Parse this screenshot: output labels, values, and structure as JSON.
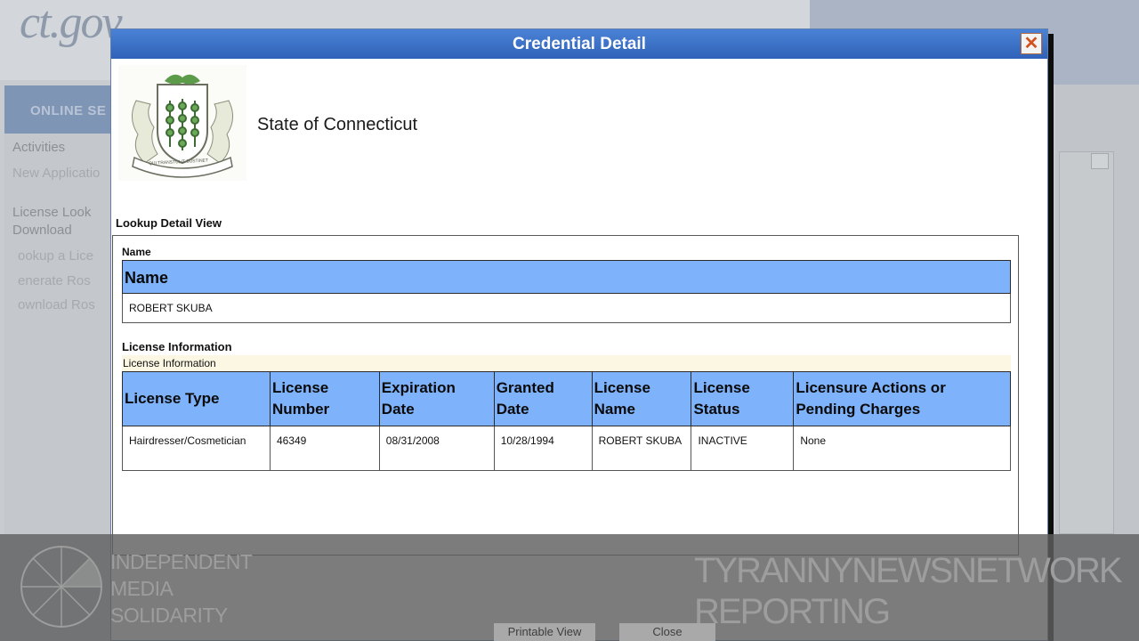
{
  "background": {
    "logo_text": "ct.gov",
    "nav_text": "ONLINE SE",
    "sidebar": {
      "activities": "Activities",
      "new_application": "New Applicatio",
      "license_lookup_line1": "License Look",
      "license_lookup_line2": "Download",
      "lookup_link": "ookup a Lice",
      "generate_link": "enerate Ros",
      "download_link": "ownload Ros"
    }
  },
  "modal": {
    "title": "Credential Detail",
    "close_glyph": "✕",
    "state_name": "State of Connecticut",
    "seal_motto": "QUI TRANSTULIT SUSTINET",
    "lookup_label": "Lookup Detail View",
    "name_section": {
      "label": "Name",
      "header": "Name",
      "value": "ROBERT SKUBA"
    },
    "license_section": {
      "label": "License Information",
      "sublabel": "License Information",
      "columns": [
        "License Type",
        "License Number",
        "Expiration Date",
        "Granted Date",
        "License Name",
        "License Status",
        "Licensure Actions or Pending Charges"
      ],
      "rows": [
        {
          "license_type": "Hairdresser/Cosmetician",
          "license_number": "46349",
          "expiration_date": "08/31/2008",
          "granted_date": "10/28/1994",
          "license_name": "ROBERT SKUBA",
          "license_status": "INACTIVE",
          "actions": "None"
        }
      ]
    },
    "buttons": {
      "printable_view": "Printable View",
      "close": "Close"
    }
  },
  "watermark": {
    "left": [
      "INDEPENDENT",
      "MEDIA",
      "SOLIDARITY"
    ],
    "right": [
      "TYRANNYNEWSNETWORK",
      "REPORTING"
    ]
  },
  "colors": {
    "titlebar": "#3a6fc7",
    "table_header": "#7eb2fb",
    "close_x": "#d2511d"
  }
}
